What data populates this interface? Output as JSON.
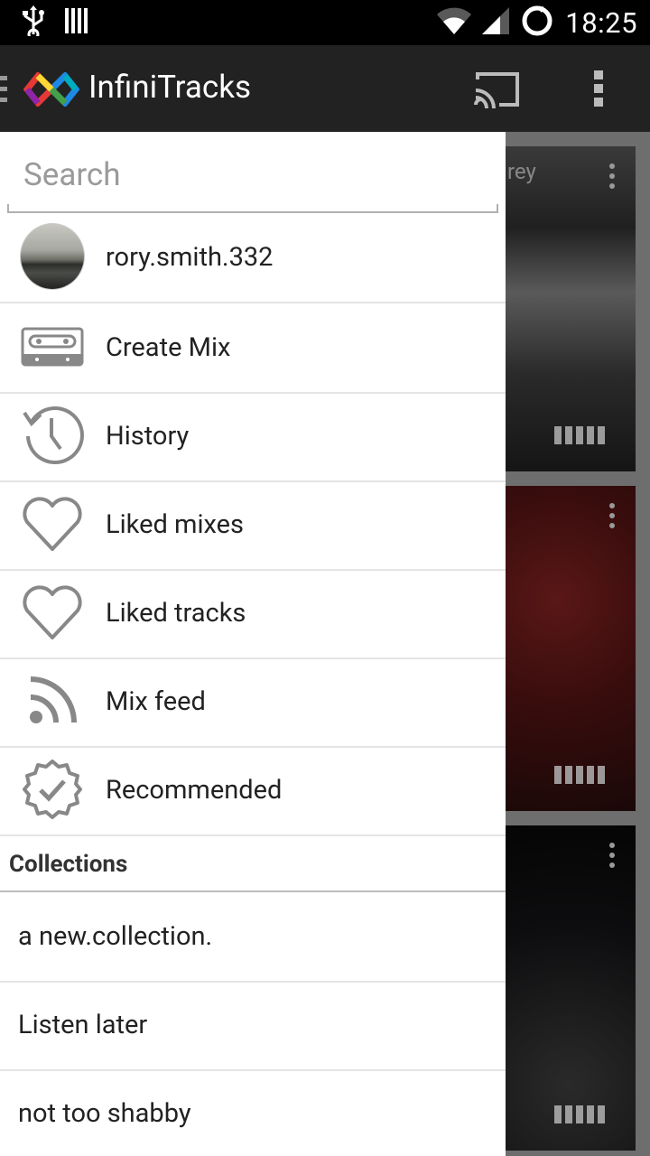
{
  "status_bar": {
    "time": "18:25"
  },
  "app_bar": {
    "title": "InfiniTracks"
  },
  "drawer": {
    "search_placeholder": "Search",
    "user": {
      "name": "rory.smith.332"
    },
    "items": [
      {
        "label": "Create Mix",
        "icon": "cassette-icon"
      },
      {
        "label": "History",
        "icon": "history-icon"
      },
      {
        "label": "Liked mixes",
        "icon": "heart-icon"
      },
      {
        "label": "Liked tracks",
        "icon": "heart-icon"
      },
      {
        "label": "Mix feed",
        "icon": "rss-feed-icon"
      },
      {
        "label": "Recommended",
        "icon": "verified-badge-icon"
      }
    ],
    "collections_header": "Collections",
    "collections": [
      {
        "label": "a new.collection."
      },
      {
        "label": "Listen later"
      },
      {
        "label": "not too shabby"
      }
    ]
  },
  "background": {
    "card1_partial_text": "rey"
  }
}
